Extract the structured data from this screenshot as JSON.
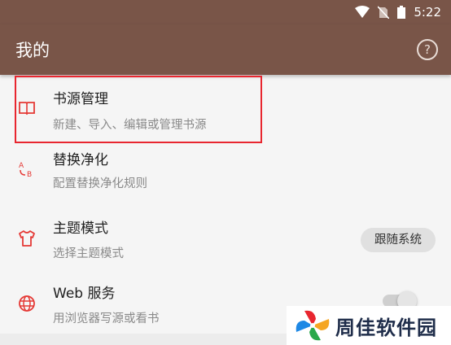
{
  "status_bar": {
    "time": "5:22"
  },
  "app_bar": {
    "title": "我的",
    "help_icon_glyph": "?"
  },
  "menu_items": [
    {
      "title": "书源管理",
      "subtitle": "新建、导入、编辑或管理书源",
      "icon": "book-open-icon"
    },
    {
      "title": "替换净化",
      "subtitle": "配置替换净化规则",
      "icon": "replace-ab-icon"
    },
    {
      "title": "主题模式",
      "subtitle": "选择主题模式",
      "icon": "shirt-icon",
      "action_label": "跟随系统"
    },
    {
      "title": "Web 服务",
      "subtitle": "用浏览器写源或看书",
      "icon": "globe-icon",
      "toggle_on": false
    }
  ],
  "watermark": {
    "text": "周佳软件园"
  },
  "colors": {
    "app_bar": "#795548",
    "accent": "#e53935",
    "highlight": "#e8262f"
  }
}
